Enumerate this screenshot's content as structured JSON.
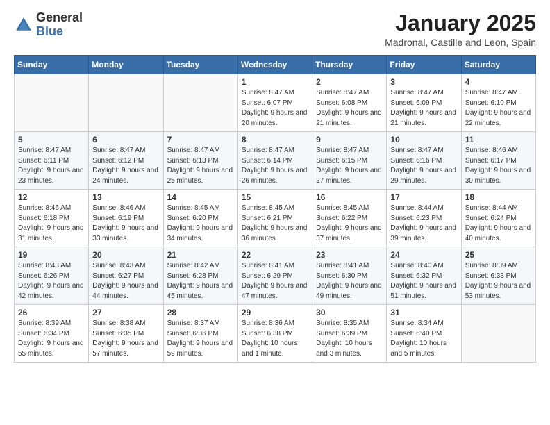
{
  "header": {
    "logo_general": "General",
    "logo_blue": "Blue",
    "month_title": "January 2025",
    "location": "Madronal, Castille and Leon, Spain"
  },
  "weekdays": [
    "Sunday",
    "Monday",
    "Tuesday",
    "Wednesday",
    "Thursday",
    "Friday",
    "Saturday"
  ],
  "weeks": [
    [
      {
        "day": "",
        "info": ""
      },
      {
        "day": "",
        "info": ""
      },
      {
        "day": "",
        "info": ""
      },
      {
        "day": "1",
        "info": "Sunrise: 8:47 AM\nSunset: 6:07 PM\nDaylight: 9 hours and 20 minutes."
      },
      {
        "day": "2",
        "info": "Sunrise: 8:47 AM\nSunset: 6:08 PM\nDaylight: 9 hours and 21 minutes."
      },
      {
        "day": "3",
        "info": "Sunrise: 8:47 AM\nSunset: 6:09 PM\nDaylight: 9 hours and 21 minutes."
      },
      {
        "day": "4",
        "info": "Sunrise: 8:47 AM\nSunset: 6:10 PM\nDaylight: 9 hours and 22 minutes."
      }
    ],
    [
      {
        "day": "5",
        "info": "Sunrise: 8:47 AM\nSunset: 6:11 PM\nDaylight: 9 hours and 23 minutes."
      },
      {
        "day": "6",
        "info": "Sunrise: 8:47 AM\nSunset: 6:12 PM\nDaylight: 9 hours and 24 minutes."
      },
      {
        "day": "7",
        "info": "Sunrise: 8:47 AM\nSunset: 6:13 PM\nDaylight: 9 hours and 25 minutes."
      },
      {
        "day": "8",
        "info": "Sunrise: 8:47 AM\nSunset: 6:14 PM\nDaylight: 9 hours and 26 minutes."
      },
      {
        "day": "9",
        "info": "Sunrise: 8:47 AM\nSunset: 6:15 PM\nDaylight: 9 hours and 27 minutes."
      },
      {
        "day": "10",
        "info": "Sunrise: 8:47 AM\nSunset: 6:16 PM\nDaylight: 9 hours and 29 minutes."
      },
      {
        "day": "11",
        "info": "Sunrise: 8:46 AM\nSunset: 6:17 PM\nDaylight: 9 hours and 30 minutes."
      }
    ],
    [
      {
        "day": "12",
        "info": "Sunrise: 8:46 AM\nSunset: 6:18 PM\nDaylight: 9 hours and 31 minutes."
      },
      {
        "day": "13",
        "info": "Sunrise: 8:46 AM\nSunset: 6:19 PM\nDaylight: 9 hours and 33 minutes."
      },
      {
        "day": "14",
        "info": "Sunrise: 8:45 AM\nSunset: 6:20 PM\nDaylight: 9 hours and 34 minutes."
      },
      {
        "day": "15",
        "info": "Sunrise: 8:45 AM\nSunset: 6:21 PM\nDaylight: 9 hours and 36 minutes."
      },
      {
        "day": "16",
        "info": "Sunrise: 8:45 AM\nSunset: 6:22 PM\nDaylight: 9 hours and 37 minutes."
      },
      {
        "day": "17",
        "info": "Sunrise: 8:44 AM\nSunset: 6:23 PM\nDaylight: 9 hours and 39 minutes."
      },
      {
        "day": "18",
        "info": "Sunrise: 8:44 AM\nSunset: 6:24 PM\nDaylight: 9 hours and 40 minutes."
      }
    ],
    [
      {
        "day": "19",
        "info": "Sunrise: 8:43 AM\nSunset: 6:26 PM\nDaylight: 9 hours and 42 minutes."
      },
      {
        "day": "20",
        "info": "Sunrise: 8:43 AM\nSunset: 6:27 PM\nDaylight: 9 hours and 44 minutes."
      },
      {
        "day": "21",
        "info": "Sunrise: 8:42 AM\nSunset: 6:28 PM\nDaylight: 9 hours and 45 minutes."
      },
      {
        "day": "22",
        "info": "Sunrise: 8:41 AM\nSunset: 6:29 PM\nDaylight: 9 hours and 47 minutes."
      },
      {
        "day": "23",
        "info": "Sunrise: 8:41 AM\nSunset: 6:30 PM\nDaylight: 9 hours and 49 minutes."
      },
      {
        "day": "24",
        "info": "Sunrise: 8:40 AM\nSunset: 6:32 PM\nDaylight: 9 hours and 51 minutes."
      },
      {
        "day": "25",
        "info": "Sunrise: 8:39 AM\nSunset: 6:33 PM\nDaylight: 9 hours and 53 minutes."
      }
    ],
    [
      {
        "day": "26",
        "info": "Sunrise: 8:39 AM\nSunset: 6:34 PM\nDaylight: 9 hours and 55 minutes."
      },
      {
        "day": "27",
        "info": "Sunrise: 8:38 AM\nSunset: 6:35 PM\nDaylight: 9 hours and 57 minutes."
      },
      {
        "day": "28",
        "info": "Sunrise: 8:37 AM\nSunset: 6:36 PM\nDaylight: 9 hours and 59 minutes."
      },
      {
        "day": "29",
        "info": "Sunrise: 8:36 AM\nSunset: 6:38 PM\nDaylight: 10 hours and 1 minute."
      },
      {
        "day": "30",
        "info": "Sunrise: 8:35 AM\nSunset: 6:39 PM\nDaylight: 10 hours and 3 minutes."
      },
      {
        "day": "31",
        "info": "Sunrise: 8:34 AM\nSunset: 6:40 PM\nDaylight: 10 hours and 5 minutes."
      },
      {
        "day": "",
        "info": ""
      }
    ]
  ]
}
